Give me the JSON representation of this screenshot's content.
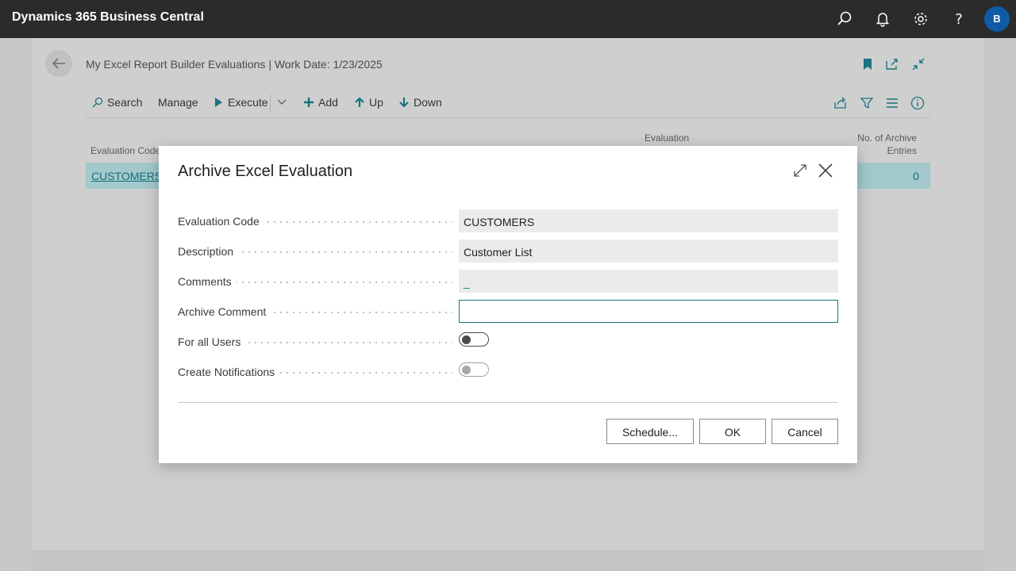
{
  "topbar": {
    "app_title": "Dynamics 365 Business Central",
    "avatar_initial": "B",
    "icons": [
      "search-icon",
      "bell-icon",
      "gear-icon",
      "help-icon"
    ]
  },
  "page": {
    "title": "My Excel Report Builder Evaluations | Work Date: 1/23/2025",
    "actions": {
      "search": "Search",
      "manage": "Manage",
      "execute": "Execute",
      "add": "Add",
      "up": "Up",
      "down": "Down"
    },
    "columns": {
      "evaluation_code": "Evaluation Code",
      "evaluation": "Evaluation",
      "archive_entries_line1": "No. of Archive",
      "archive_entries_line2": "Entries"
    },
    "row": {
      "code": "CUSTOMERS",
      "archive_entries": "0"
    }
  },
  "dialog": {
    "title": "Archive Excel Evaluation",
    "fields": {
      "evaluation_code": {
        "label": "Evaluation Code",
        "value": "CUSTOMERS"
      },
      "description": {
        "label": "Description",
        "value": "Customer List"
      },
      "comments": {
        "label": "Comments",
        "value": "_"
      },
      "archive_comment": {
        "label": "Archive Comment",
        "value": ""
      },
      "for_all_users": {
        "label": "For all Users",
        "on": false
      },
      "create_notifications": {
        "label": "Create Notifications",
        "on": false
      }
    },
    "buttons": {
      "schedule": "Schedule...",
      "ok": "OK",
      "cancel": "Cancel"
    }
  },
  "colors": {
    "topbar": "#2b2b2b",
    "accent": "#1a7380",
    "selected_row": "#a3c9cc",
    "avatar": "#0f5ba7"
  }
}
